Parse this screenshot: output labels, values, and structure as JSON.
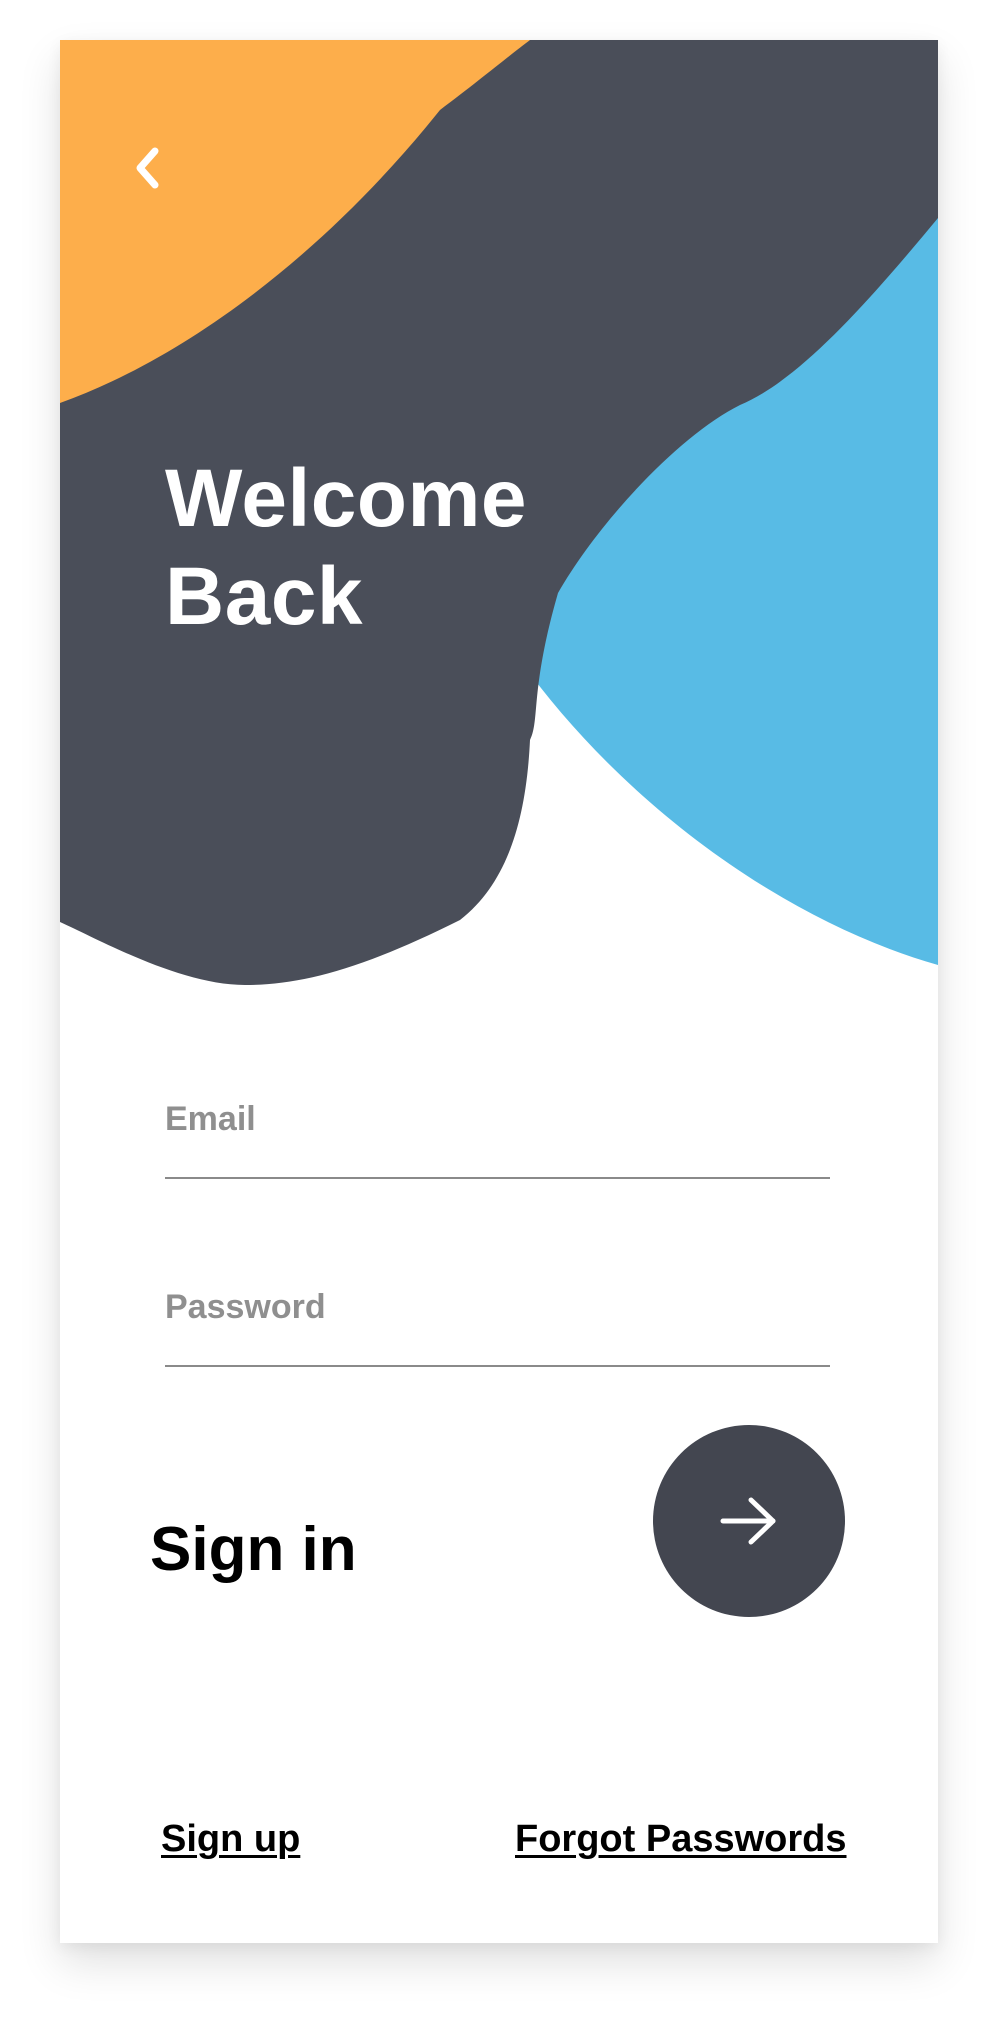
{
  "colors": {
    "orange": "#FDAE4B",
    "dark": "#4A4E59",
    "blue": "#58BBE5",
    "button_bg": "#434650",
    "placeholder": "#8F8F8F"
  },
  "header": {
    "back_icon": "chevron-left-icon",
    "title_line_1": "Welcome",
    "title_line_2": "Back"
  },
  "form": {
    "email_placeholder": "Email",
    "password_placeholder": "Password",
    "signin_label": "Sign in",
    "submit_icon": "arrow-right-icon"
  },
  "footer": {
    "signup_label": "Sign up",
    "forgot_label": "Forgot Passwords"
  }
}
